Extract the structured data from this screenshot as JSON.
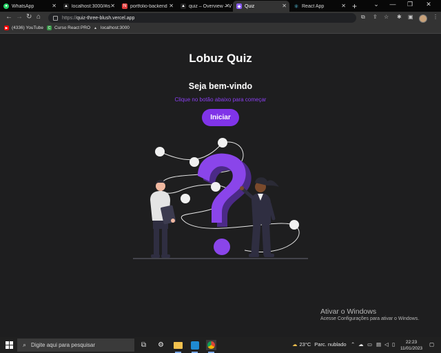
{
  "browser": {
    "tabs": [
      {
        "label": "WhatsApp",
        "icon": "whatsapp-icon",
        "color": "#25d366",
        "active": false
      },
      {
        "label": "localhost:3000/#is",
        "icon": "triangle-icon",
        "color": "#222222",
        "active": false
      },
      {
        "label": "portfolio-backend",
        "icon": "nest-icon",
        "color": "#e03b3b",
        "active": false
      },
      {
        "label": "quiz – Overview – V",
        "icon": "triangle-icon",
        "color": "#222222",
        "active": false
      },
      {
        "label": "Quiz",
        "icon": "quiz-icon",
        "color": "#8a5cf6",
        "active": true
      },
      {
        "label": "React App",
        "icon": "react-icon",
        "color": "#61dafb",
        "active": false
      }
    ],
    "address": {
      "protocol": "https://",
      "host": "quiz-three-blush.vercel.app"
    },
    "bookmarks": [
      {
        "label": "(4336) YouTube",
        "icon": "youtube-icon",
        "color": "#ff0000"
      },
      {
        "label": "Curso React PRO",
        "icon": "bookmark-icon",
        "color": "#3a9a4a"
      },
      {
        "label": "localhost:3000",
        "icon": "triangle-icon",
        "color": "#333333"
      }
    ]
  },
  "page": {
    "title": "Lobuz Quiz",
    "welcome": "Seja bem-vindo",
    "subtitle": "Clique no botão abaixo para começar",
    "start_button": "Iniciar",
    "accent_color": "#8034e8"
  },
  "watermark": {
    "line1": "Ativar o Windows",
    "line2": "Acesse Configurações para ativar o Windows."
  },
  "taskbar": {
    "search_placeholder": "Digite aqui para pesquisar",
    "weather_temp": "23°C",
    "weather_desc": "Parc. nublado",
    "time": "22:23",
    "date": "11/01/2023"
  }
}
